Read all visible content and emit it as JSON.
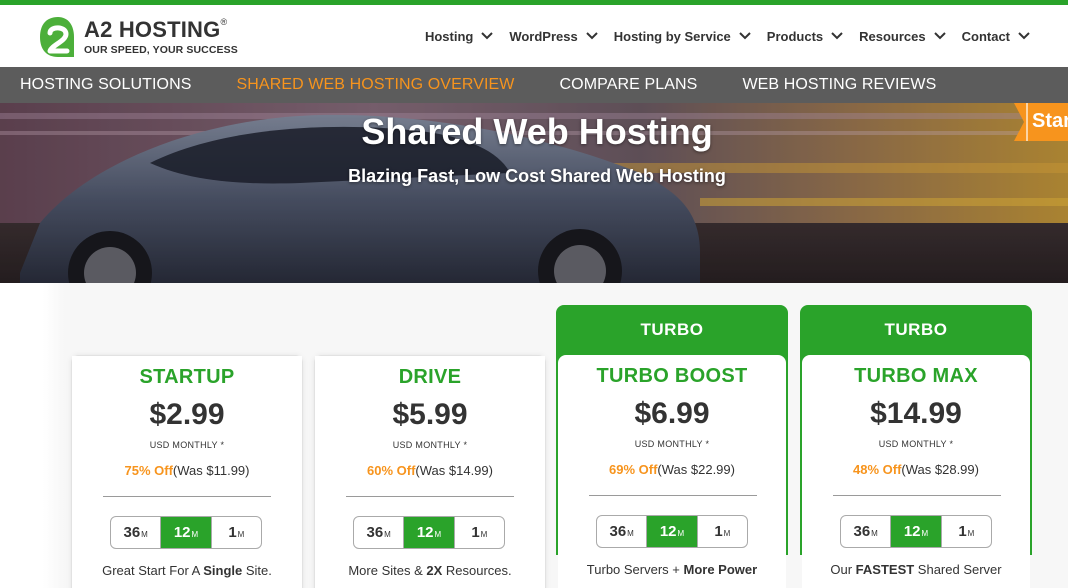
{
  "brand": {
    "name": "A2 HOSTING",
    "registered": "®",
    "tagline": "OUR SPEED, YOUR SUCCESS",
    "colors": {
      "green": "#2aa32a",
      "orange": "#f7941d",
      "subnav_bg": "#5c5c5c"
    }
  },
  "main_nav": {
    "items": [
      {
        "label": "Hosting"
      },
      {
        "label": "WordPress"
      },
      {
        "label": "Hosting by Service"
      },
      {
        "label": "Products"
      },
      {
        "label": "Resources"
      },
      {
        "label": "Contact"
      }
    ],
    "icon": "chevron-down-icon"
  },
  "sub_nav": {
    "items": [
      {
        "label": "HOSTING SOLUTIONS",
        "active": false
      },
      {
        "label": "SHARED WEB HOSTING OVERVIEW",
        "active": true
      },
      {
        "label": "COMPARE PLANS",
        "active": false
      },
      {
        "label": "WEB HOSTING REVIEWS",
        "active": false
      }
    ]
  },
  "hero": {
    "title": "Shared Web Hosting",
    "subtitle": "Blazing Fast, Low Cost Shared Web Hosting",
    "side_tab": "Star"
  },
  "plans": [
    {
      "ribbon": "",
      "name": "STARTUP",
      "price": "$2.99",
      "period": "USD MONTHLY *",
      "discount": "75% Off",
      "was": "(Was $11.99)",
      "terms": [
        {
          "num": "36",
          "unit": "M"
        },
        {
          "num": "12",
          "unit": "M"
        },
        {
          "num": "1",
          "unit": "M"
        }
      ],
      "selected_term": "12",
      "desc_pre": "Great Start For A ",
      "desc_bold": "Single",
      "desc_post": " Site."
    },
    {
      "ribbon": "",
      "name": "DRIVE",
      "price": "$5.99",
      "period": "USD MONTHLY *",
      "discount": "60% Off",
      "was": "(Was $14.99)",
      "terms": [
        {
          "num": "36",
          "unit": "M"
        },
        {
          "num": "12",
          "unit": "M"
        },
        {
          "num": "1",
          "unit": "M"
        }
      ],
      "selected_term": "12",
      "desc_pre": "More Sites & ",
      "desc_bold": "2X",
      "desc_post": " Resources."
    },
    {
      "ribbon": "TURBO",
      "name": "TURBO BOOST",
      "price": "$6.99",
      "period": "USD MONTHLY *",
      "discount": "69% Off",
      "was": "(Was $22.99)",
      "terms": [
        {
          "num": "36",
          "unit": "M"
        },
        {
          "num": "12",
          "unit": "M"
        },
        {
          "num": "1",
          "unit": "M"
        }
      ],
      "selected_term": "12",
      "desc_pre": "Turbo Servers + ",
      "desc_bold": "More Power",
      "desc_post": ""
    },
    {
      "ribbon": "TURBO",
      "name": "TURBO MAX",
      "price": "$14.99",
      "period": "USD MONTHLY *",
      "discount": "48% Off",
      "was": "(Was $28.99)",
      "terms": [
        {
          "num": "36",
          "unit": "M"
        },
        {
          "num": "12",
          "unit": "M"
        },
        {
          "num": "1",
          "unit": "M"
        }
      ],
      "selected_term": "12",
      "desc_pre": "Our ",
      "desc_bold": "FASTEST",
      "desc_post": " Shared Server"
    }
  ]
}
